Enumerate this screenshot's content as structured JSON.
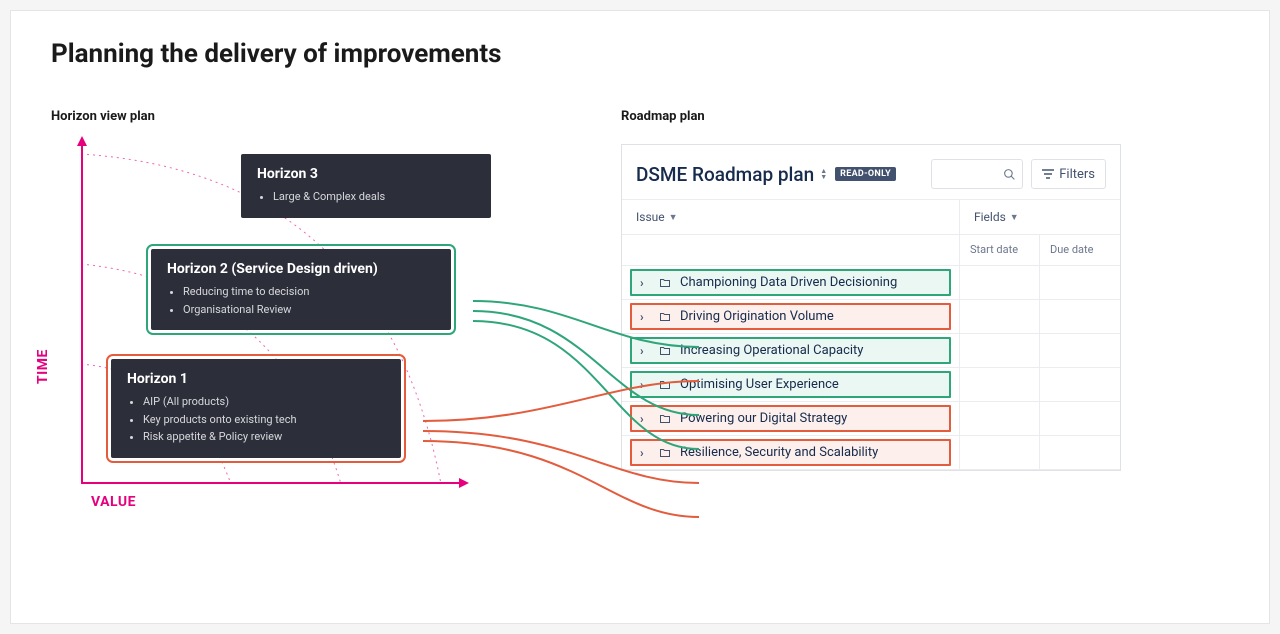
{
  "page": {
    "title": "Planning the delivery of improvements"
  },
  "left": {
    "section_label": "Horizon view plan",
    "axis_x": "VALUE",
    "axis_y": "TIME",
    "horizons": [
      {
        "title": "Horizon 3",
        "bullets": [
          "Large & Complex deals"
        ]
      },
      {
        "title": "Horizon 2 (Service Design driven)",
        "bullets": [
          "Reducing time to decision",
          "Organisational Review"
        ]
      },
      {
        "title": "Horizon 1",
        "bullets": [
          "AIP (All products)",
          "Key products onto existing tech",
          "Risk appetite & Policy review"
        ]
      }
    ]
  },
  "right": {
    "section_label": "Roadmap plan",
    "panel_title": "DSME Roadmap plan",
    "readonly_badge": "READ-ONLY",
    "filters_label": "Filters",
    "columns": {
      "issue": "Issue",
      "fields": "Fields",
      "start": "Start date",
      "due": "Due date"
    },
    "issues": [
      {
        "label": "Championing Data Driven Decisioning",
        "color": "green"
      },
      {
        "label": "Driving Origination Volume",
        "color": "red"
      },
      {
        "label": "Increasing Operational Capacity",
        "color": "green"
      },
      {
        "label": "Optimising User Experience",
        "color": "green"
      },
      {
        "label": "Powering our Digital Strategy",
        "color": "red"
      },
      {
        "label": "Resilience, Security and Scalability",
        "color": "red"
      }
    ]
  },
  "colors": {
    "magenta": "#e6007e",
    "green": "#2fa57a",
    "red": "#e25c3d"
  }
}
